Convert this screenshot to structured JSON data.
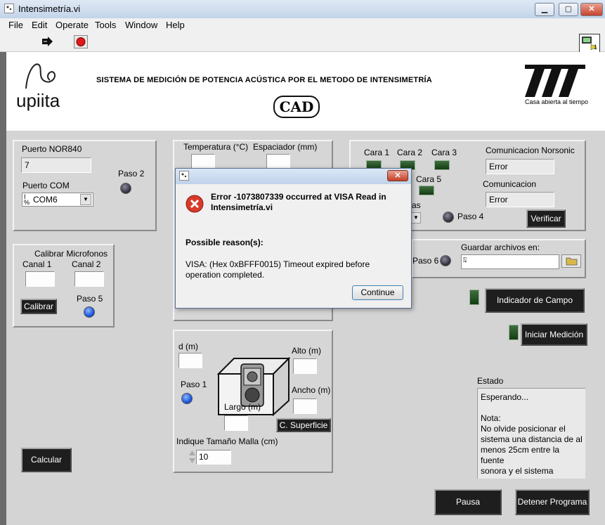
{
  "window": {
    "title": "Intensimetría.vi",
    "tray_num": "1"
  },
  "menu": [
    "File",
    "Edit",
    "Operate",
    "Tools",
    "Window",
    "Help"
  ],
  "header": {
    "title": "SISTEMA   DE MEDICIÓN DE POTENCIA ACÚSTICA POR EL METODO DE INTENSIMETRÍA",
    "logo_left_text": "upiita",
    "center_logo": "CAD",
    "uam_caption": "Casa abierta al tiempo"
  },
  "nor": {
    "puerto_label": "Puerto NOR840",
    "puerto_value": "7",
    "com_label": "Puerto COM",
    "com_value": "COM6",
    "paso2": "Paso 2"
  },
  "temp": {
    "temp_label": "Temperatura (°C)",
    "esp_label": "Espaciador (mm)"
  },
  "caras": {
    "c1": "Cara 1",
    "c2": "Cara 2",
    "c3": "Cara 3",
    "c5": "Cara 5",
    "as": "as",
    "norsonic_label": "Comunicacion Norsonic",
    "norsonic_value": "Error",
    "com_label": "Comunicacion",
    "com_value": "Error",
    "paso4": "Paso 4",
    "verificar": "Verificar"
  },
  "calibrar": {
    "title": "Calibrar Microfonos",
    "canal1": "Canal 1",
    "canal2": "Canal 2",
    "btn": "Calibrar",
    "paso5": "Paso 5"
  },
  "guardar": {
    "paso6": "Paso 6",
    "label": "Guardar archivos en:"
  },
  "buttons": {
    "indicador": "Indicador de Campo",
    "iniciar": "Iniciar Medición",
    "calcular": "Calcular",
    "pausa": "Pausa",
    "detener": "Detener Programa",
    "superficie": "C. Superficie"
  },
  "dims": {
    "d": "d (m)",
    "alto": "Alto (m)",
    "ancho": "Ancho (m)",
    "largo": "Largo (m)",
    "paso1": "Paso 1",
    "malla_label": "Indique Tamaño Malla (cm)",
    "malla_value": "10"
  },
  "estado": {
    "label": "Estado",
    "lines": [
      "Esperando...",
      "",
      "Nota:",
      "No olvide posicionar el",
      "sistema una distancia de al",
      "menos 25cm entre la",
      "fuente",
      "sonora y el sistema"
    ]
  },
  "dialog": {
    "error_title": "Error -1073807339 occurred at VISA Read in Intensimetría.vi",
    "reasons_label": "Possible reason(s):",
    "reason": "VISA:  (Hex 0xBFFF0015) Timeout expired before operation completed.",
    "continue": "Continue"
  },
  "icons": {
    "run": "run-arrow-icon",
    "stop": "abort-icon",
    "error": "error-x-icon",
    "folder": "folder-icon"
  },
  "colors": {
    "led_green": "#1f5a1f",
    "led_blue": "#1450d8",
    "error_red": "#d83a2a"
  }
}
